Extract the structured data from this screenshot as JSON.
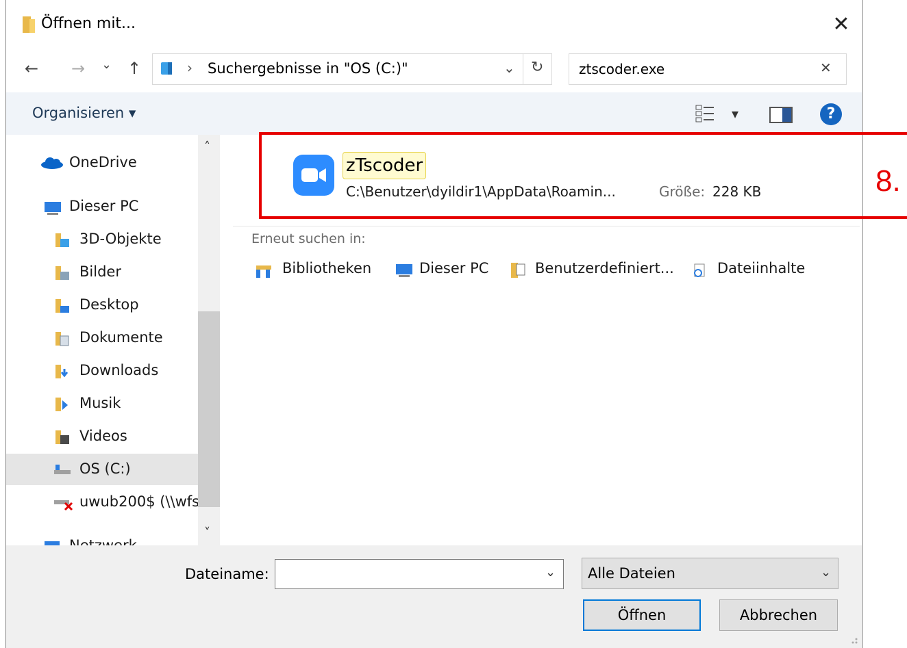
{
  "window": {
    "title": "Öffnen mit...",
    "close_label": "✕"
  },
  "nav": {
    "back": "←",
    "forward": "→",
    "recent": "⌄",
    "up": "↑"
  },
  "address": {
    "sep": "›",
    "path": "Suchergebnisse in \"OS (C:)\"",
    "dropdown": "⌄",
    "refresh": "↻"
  },
  "search": {
    "value": "ztscoder.exe",
    "clear": "✕"
  },
  "toolbar": {
    "organize": "Organisieren ▾",
    "view_arrow": "▾",
    "help": "?"
  },
  "sidebar": {
    "scroll_up": "˄",
    "scroll_down": "˅",
    "items": [
      {
        "label": "OneDrive"
      },
      {
        "label": "Dieser PC"
      },
      {
        "label": "3D-Objekte"
      },
      {
        "label": "Bilder"
      },
      {
        "label": "Desktop"
      },
      {
        "label": "Dokumente"
      },
      {
        "label": "Downloads"
      },
      {
        "label": "Musik"
      },
      {
        "label": "Videos"
      },
      {
        "label": "OS (C:)"
      },
      {
        "label": "uwub200$ (\\\\wfs"
      },
      {
        "label": "Netzwerk"
      }
    ]
  },
  "result": {
    "name": "zTscoder",
    "path": "C:\\Benutzer\\dyildir1\\AppData\\Roamin...",
    "size_label": "Größe:",
    "size_value": "228 KB",
    "step_label": "8."
  },
  "search_again": {
    "header": "Erneut suchen in:",
    "items": [
      {
        "label": "Bibliotheken"
      },
      {
        "label": "Dieser PC"
      },
      {
        "label": "Benutzerdefiniert..."
      },
      {
        "label": "Dateiinhalte"
      }
    ]
  },
  "footer": {
    "filename_label": "Dateiname:",
    "filename_value": "",
    "filter_value": "Alle Dateien",
    "open_label": "Öffnen",
    "cancel_label": "Abbrechen"
  },
  "colors": {
    "accent": "#0078d7",
    "highlight_border": "#e60000",
    "zoom_blue": "#2d8cff"
  }
}
